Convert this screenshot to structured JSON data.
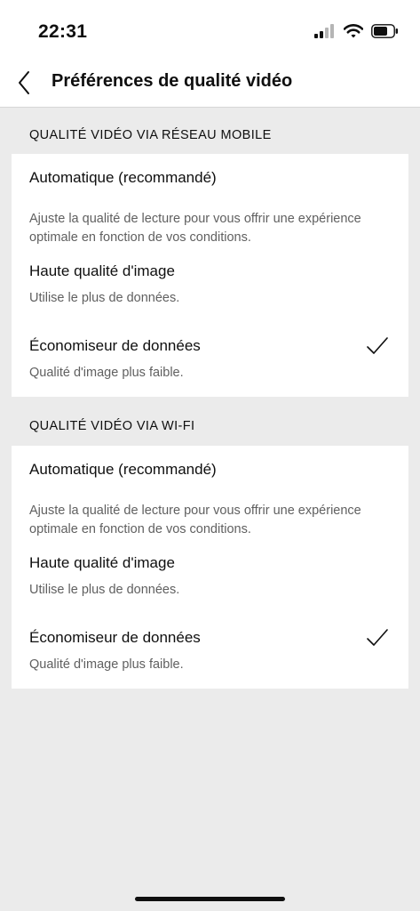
{
  "status": {
    "time": "22:31",
    "icons": [
      "cellular-signal-icon",
      "wifi-icon",
      "battery-icon"
    ]
  },
  "nav": {
    "back_icon": "chevron-left-icon",
    "title": "Préférences de qualité vidéo"
  },
  "sections": [
    {
      "header": "QUALITÉ VIDÉO VIA RÉSEAU MOBILE",
      "options": [
        {
          "title": "Automatique (recommandé)",
          "description": "Ajuste la qualité de lecture pour vous offrir une expérience optimale en fonction de vos conditions.",
          "selected": false
        },
        {
          "title": "Haute qualité d'image",
          "description": "Utilise le plus de données.",
          "selected": false
        },
        {
          "title": "Économiseur de données",
          "description": "Qualité d'image plus faible.",
          "selected": true
        }
      ]
    },
    {
      "header": "QUALITÉ VIDÉO VIA WI-FI",
      "options": [
        {
          "title": "Automatique (recommandé)",
          "description": "Ajuste la qualité de lecture pour vous offrir une expérience optimale en fonction de vos conditions.",
          "selected": false
        },
        {
          "title": "Haute qualité d'image",
          "description": "Utilise le plus de données.",
          "selected": false
        },
        {
          "title": "Économiseur de données",
          "description": "Qualité d'image plus faible.",
          "selected": true
        }
      ]
    }
  ],
  "colors": {
    "background": "#ebebeb",
    "card": "#ffffff",
    "text": "#0f0f0f",
    "secondary_text": "#606060"
  }
}
